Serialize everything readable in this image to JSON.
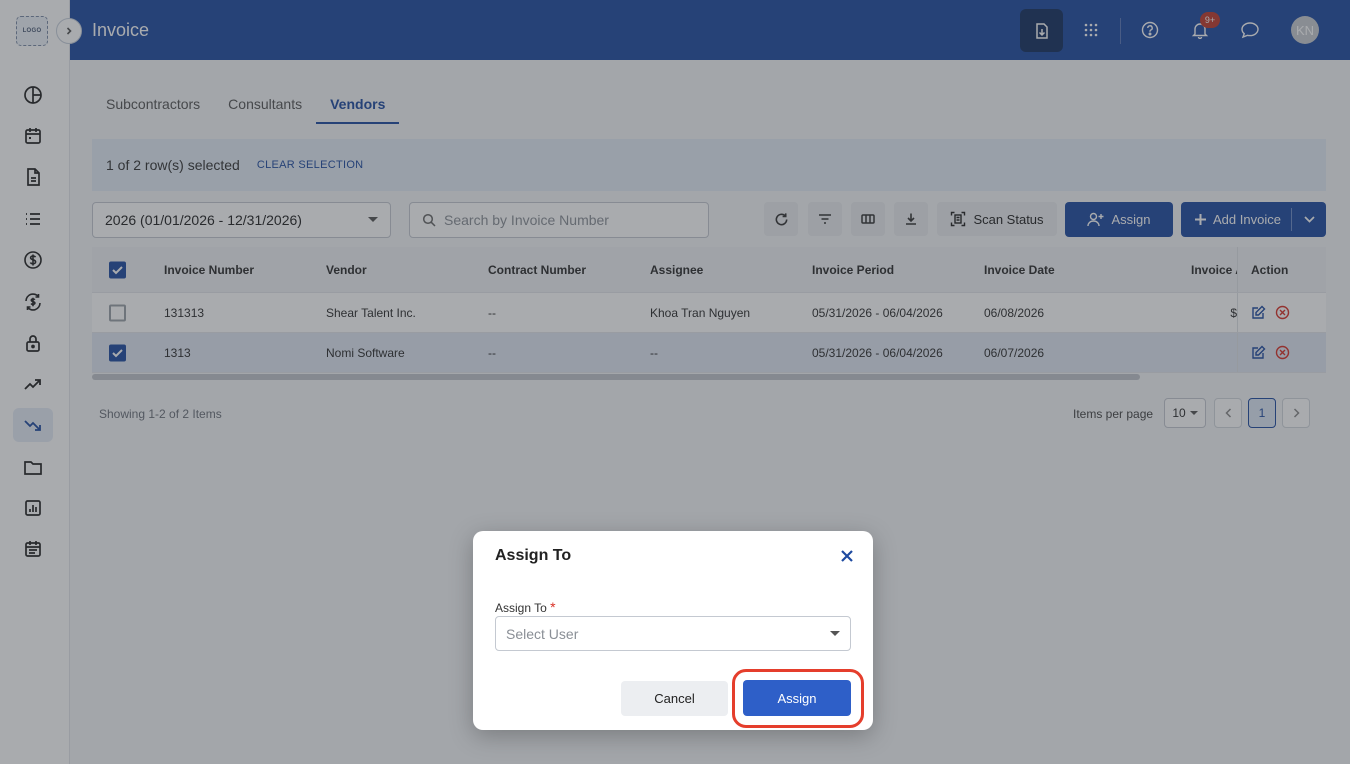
{
  "app": {
    "logo_text": "LOGO",
    "page_title": "Invoice"
  },
  "colors": {
    "primary": "#1e4aa0",
    "badge": "#c0392b",
    "highlight": "#e53e2c",
    "selection_bg": "#e4edf7"
  },
  "header": {
    "icons": [
      "download-doc-icon",
      "apps-grid-icon",
      "help-icon",
      "bell-icon",
      "chat-icon"
    ],
    "notifications_badge": "9+",
    "avatar_initials": "KN"
  },
  "sidebar": {
    "items": [
      {
        "icon": "dashboard-icon"
      },
      {
        "icon": "calendar-icon"
      },
      {
        "icon": "document-icon"
      },
      {
        "icon": "list-icon"
      },
      {
        "icon": "dollar-icon"
      },
      {
        "icon": "currency-exchange-icon"
      },
      {
        "icon": "lock-icon"
      },
      {
        "icon": "trending-up-icon"
      },
      {
        "icon": "trending-down-icon",
        "active": true
      },
      {
        "icon": "folder-icon"
      },
      {
        "icon": "report-chart-icon"
      },
      {
        "icon": "schedule-icon"
      }
    ]
  },
  "tabs": [
    {
      "label": "Subcontractors",
      "active": false
    },
    {
      "label": "Consultants",
      "active": false
    },
    {
      "label": "Vendors",
      "active": true
    }
  ],
  "selection": {
    "text": "1 of 2 row(s) selected",
    "clear_label": "CLEAR SELECTION"
  },
  "toolbar": {
    "year_filter": "2026 (01/01/2026 - 12/31/2026)",
    "search_placeholder": "Search by Invoice Number",
    "scan_status_label": "Scan Status",
    "assign_label": "Assign",
    "add_invoice_label": "Add Invoice"
  },
  "table": {
    "header_checked": true,
    "columns": [
      "Invoice Number",
      "Vendor",
      "Contract Number",
      "Assignee",
      "Invoice Period",
      "Invoice Date",
      "Invoice Amount",
      "Action"
    ],
    "rows": [
      {
        "checked": false,
        "invoice_number": "131313",
        "vendor": "Shear Talent Inc.",
        "contract_number": "--",
        "assignee": "Khoa Tran Nguyen",
        "invoice_period": "05/31/2026 - 06/04/2026",
        "invoice_date": "06/08/2026",
        "invoice_amount": "$"
      },
      {
        "checked": true,
        "invoice_number": "1313",
        "vendor": "Nomi Software",
        "contract_number": "--",
        "assignee": "--",
        "invoice_period": "05/31/2026 - 06/04/2026",
        "invoice_date": "06/07/2026",
        "invoice_amount": ""
      }
    ]
  },
  "pagination": {
    "showing": "Showing 1-2 of 2 Items",
    "items_per_page_label": "Items per page",
    "items_per_page": "10",
    "current_page": "1"
  },
  "modal": {
    "title": "Assign To",
    "field_label": "Assign To",
    "required_mark": "*",
    "select_placeholder": "Select User",
    "cancel_label": "Cancel",
    "assign_label": "Assign"
  }
}
